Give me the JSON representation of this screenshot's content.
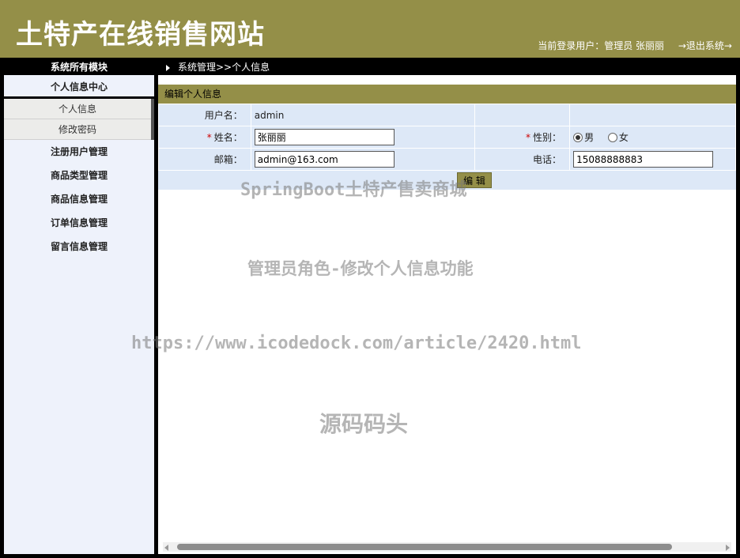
{
  "header": {
    "title": "土特产在线销售网站",
    "user_label": "当前登录用户：管理员 张丽丽",
    "logout_label": "→退出系统→"
  },
  "nav": {
    "modules_title": "系统所有模块",
    "breadcrumb": "系统管理>>个人信息"
  },
  "sidebar": {
    "section_title": "个人信息中心",
    "sub_items": [
      "个人信息",
      "修改密码"
    ],
    "items": [
      "注册用户管理",
      "商品类型管理",
      "商品信息管理",
      "订单信息管理",
      "留言信息管理"
    ]
  },
  "form": {
    "panel_title": "编辑个人信息",
    "username_label": "用户名：",
    "username_value": "admin",
    "name_label": "姓名：",
    "name_value": "张丽丽",
    "gender_label": "性别：",
    "gender_male": "男",
    "gender_female": "女",
    "gender_selected": "男",
    "email_label": "邮箱：",
    "email_value": "admin@163.com",
    "phone_label": "电话：",
    "phone_value": "15088888883",
    "required_mark": "*",
    "edit_button": "编 辑"
  },
  "watermarks": {
    "line1": "SpringBoot土特产售卖商城",
    "line2": "管理员角色-修改个人信息功能",
    "line3": "https://www.icodedock.com/article/2420.html",
    "line4": "源码码头"
  },
  "colors": {
    "brand": "#948f48",
    "row_bg": "#dde8f7",
    "sidebar_bg": "#eef2fb"
  }
}
